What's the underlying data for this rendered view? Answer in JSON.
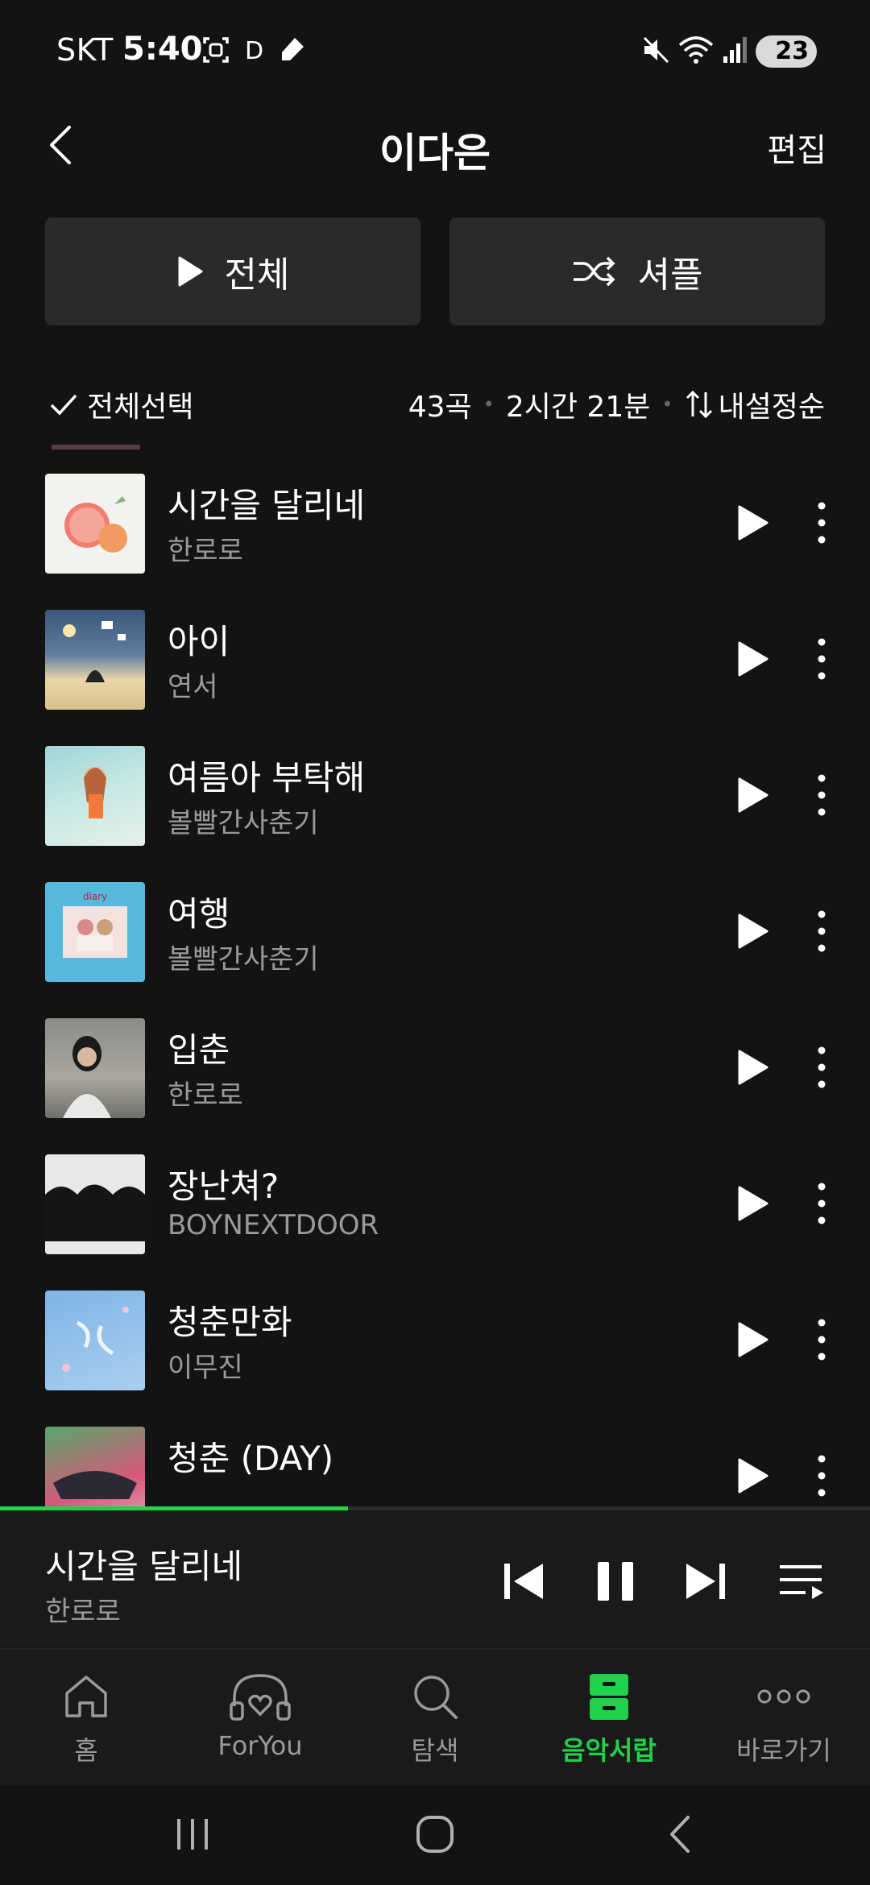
{
  "status_bar": {
    "carrier": "SKT",
    "time": "5:40",
    "d_indicator": "D",
    "battery": "23"
  },
  "header": {
    "title": "이다은",
    "edit": "편집"
  },
  "actions": {
    "play_all": "전체",
    "shuffle": "셔플"
  },
  "list_meta": {
    "select_all": "전체선택",
    "count": "43곡",
    "duration": "2시간 21분",
    "sort": "내설정순"
  },
  "tracks": [
    {
      "title": "시간을 달리네",
      "artist": "한로로"
    },
    {
      "title": "아이",
      "artist": "연서"
    },
    {
      "title": "여름아 부탁해",
      "artist": "볼빨간사춘기"
    },
    {
      "title": "여행",
      "artist": "볼빨간사춘기"
    },
    {
      "title": "입춘",
      "artist": "한로로"
    },
    {
      "title": "장난쳐?",
      "artist": "BOYNEXTDOOR"
    },
    {
      "title": "청춘만화",
      "artist": "이무진"
    },
    {
      "title": "청춘 (DAY)",
      "artist": ""
    }
  ],
  "now_playing": {
    "title": "시간을 달리네",
    "artist": "한로로",
    "progress": 0.4
  },
  "bottom_nav": [
    {
      "label": "홈",
      "icon": "home-icon"
    },
    {
      "label": "ForYou",
      "icon": "headphones-heart-icon"
    },
    {
      "label": "탐색",
      "icon": "search-icon"
    },
    {
      "label": "음악서랍",
      "icon": "drawer-icon",
      "active": true
    },
    {
      "label": "바로가기",
      "icon": "more-icon"
    }
  ],
  "colors": {
    "accent": "#1ed24b",
    "background": "#131313",
    "surface": "#2a2a2a"
  }
}
